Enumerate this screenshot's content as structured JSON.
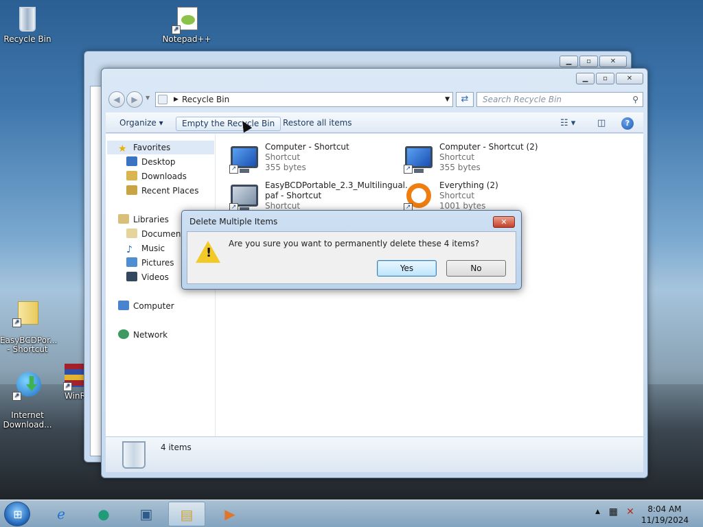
{
  "desktop": {
    "icons": [
      {
        "label": "Recycle Bin",
        "icon": "recycle-bin-icon"
      },
      {
        "label": "Notepad++",
        "icon": "notepadpp-icon"
      },
      {
        "label": "EasyBCDPor...\n- Shortcut",
        "icon": "folder-shortcut-icon"
      },
      {
        "label": "Internet\nDownload...",
        "icon": "idm-icon"
      },
      {
        "label": "WinR",
        "icon": "winrar-icon"
      }
    ]
  },
  "explorer": {
    "address": "Recycle Bin",
    "search_placeholder": "Search Recycle Bin",
    "toolbar": {
      "organize": "Organize",
      "empty_bin": "Empty the Recycle Bin",
      "restore_all": "Restore all items"
    },
    "nav": {
      "favorites": "Favorites",
      "desktop": "Desktop",
      "downloads": "Downloads",
      "recent": "Recent Places",
      "libraries": "Libraries",
      "documents": "Documents",
      "music": "Music",
      "pictures": "Pictures",
      "videos": "Videos",
      "computer": "Computer",
      "network": "Network"
    },
    "files": [
      {
        "name": "Computer - Shortcut",
        "type": "Shortcut",
        "size": "355 bytes"
      },
      {
        "name": "Computer - Shortcut (2)",
        "type": "Shortcut",
        "size": "355 bytes"
      },
      {
        "name": "EasyBCDPortable_2.3_Multilingual.",
        "name2": "paf - Shortcut",
        "type": "Shortcut"
      },
      {
        "name": "Everything (2)",
        "type": "Shortcut",
        "size": "1001 bytes"
      }
    ],
    "status": "4 items"
  },
  "dialog": {
    "title": "Delete Multiple Items",
    "message": "Are you sure you want to permanently delete these 4 items?",
    "yes": "Yes",
    "no": "No"
  },
  "taskbar": {
    "time": "8:04 AM",
    "date": "11/19/2024"
  }
}
